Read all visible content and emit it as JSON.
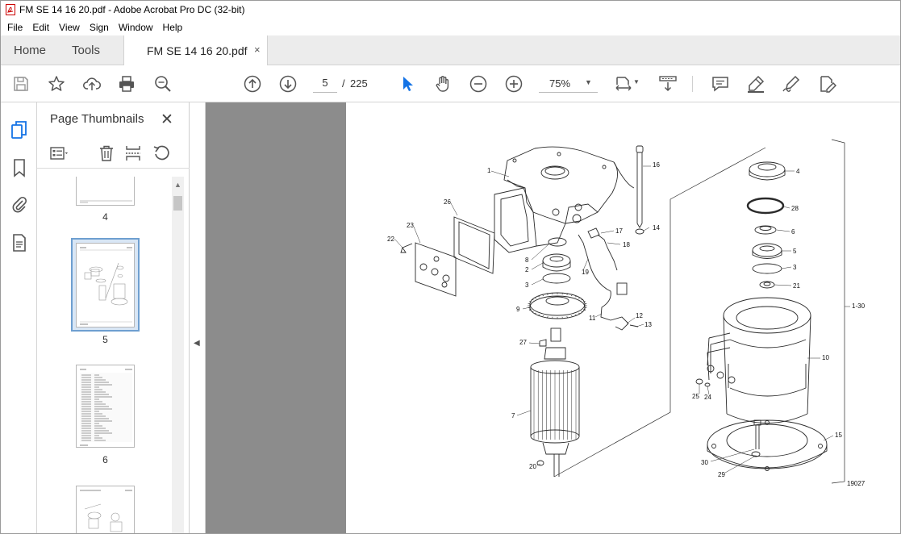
{
  "window": {
    "title": "FM SE 14 16 20.pdf - Adobe Acrobat Pro DC (32-bit)"
  },
  "menu": [
    "File",
    "Edit",
    "View",
    "Sign",
    "Window",
    "Help"
  ],
  "tabs": {
    "home": "Home",
    "tools": "Tools",
    "document": "FM SE 14 16 20.pdf",
    "close_glyph": "×"
  },
  "toolbar": {
    "page_current": "5",
    "page_separator": "/",
    "page_total": "225",
    "zoom": "75%",
    "icons": [
      "save-icon",
      "bookmark-star-icon",
      "upload-icon",
      "print-icon",
      "search-zoom-icon",
      "previous-page-icon",
      "next-page-icon",
      "select-cursor-icon",
      "hand-icon",
      "zoom-out-icon",
      "zoom-in-icon",
      "page-fit-icon",
      "scroll-mode-icon",
      "comment-icon",
      "highlight-icon",
      "sign-icon",
      "edit-pdf-icon"
    ],
    "accent": "#1473e6"
  },
  "panel": {
    "title": "Page Thumbnails",
    "close_glyph": "✕",
    "thumbnails": [
      {
        "label": "4"
      },
      {
        "label": "5",
        "selected": true
      },
      {
        "label": "6"
      }
    ]
  },
  "page": {
    "callouts": [
      "1",
      "16",
      "4",
      "26",
      "28",
      "23",
      "22",
      "17",
      "6",
      "14",
      "18",
      "8",
      "5",
      "2",
      "19",
      "3",
      "3",
      "21",
      "9",
      "12",
      "1-30",
      "11",
      "13",
      "27",
      "10",
      "7",
      "25",
      "24",
      "15",
      "20",
      "30",
      "29",
      "19027"
    ]
  }
}
